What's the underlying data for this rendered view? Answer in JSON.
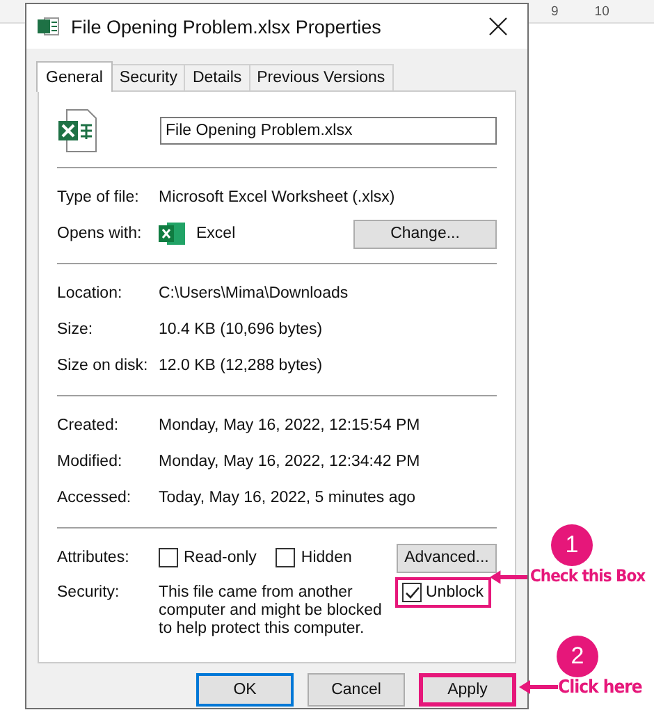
{
  "ruler": {
    "labels": [
      "9",
      "10"
    ]
  },
  "window": {
    "title": "File Opening Problem.xlsx Properties"
  },
  "tabs": [
    {
      "label": "General",
      "selected": true
    },
    {
      "label": "Security",
      "selected": false
    },
    {
      "label": "Details",
      "selected": false
    },
    {
      "label": "Previous Versions",
      "selected": false
    }
  ],
  "file_name": {
    "value": "File Opening Problem.xlsx"
  },
  "groups": [
    [
      {
        "kind": "text",
        "label": "Type of file:",
        "value": "Microsoft Excel Worksheet (.xlsx)"
      },
      {
        "kind": "app",
        "label": "Opens with:",
        "value": "Excel",
        "button": "Change..."
      }
    ],
    [
      {
        "kind": "text",
        "label": "Location:",
        "value": "C:\\Users\\Mima\\Downloads"
      },
      {
        "kind": "text",
        "label": "Size:",
        "value": "10.4 KB (10,696 bytes)"
      },
      {
        "kind": "text",
        "label": "Size on disk:",
        "value": "12.0 KB (12,288 bytes)"
      }
    ],
    [
      {
        "kind": "text",
        "label": "Created:",
        "value": "Monday, May 16, 2022, 12:15:54 PM"
      },
      {
        "kind": "text",
        "label": "Modified:",
        "value": "Monday, May 16, 2022, 12:34:42 PM"
      },
      {
        "kind": "text",
        "label": "Accessed:",
        "value": "Today, May 16, 2022, 5 minutes ago"
      }
    ]
  ],
  "attributes": {
    "label": "Attributes:",
    "options": [
      {
        "label": "Read-only",
        "checked": false
      },
      {
        "label": "Hidden",
        "checked": false
      }
    ],
    "button": "Advanced..."
  },
  "security": {
    "label": "Security:",
    "text": "This file came from another computer and might be blocked to help protect this computer.",
    "unblock": {
      "label": "Unblock",
      "checked": true,
      "highlighted": true
    }
  },
  "buttons": [
    {
      "label": "OK",
      "default": true,
      "highlighted": false
    },
    {
      "label": "Cancel",
      "default": false,
      "highlighted": false
    },
    {
      "label": "Apply",
      "default": false,
      "highlighted": true
    }
  ],
  "callouts": [
    {
      "number": "1",
      "text": "Check this Box"
    },
    {
      "number": "2",
      "text": "Click here"
    }
  ]
}
